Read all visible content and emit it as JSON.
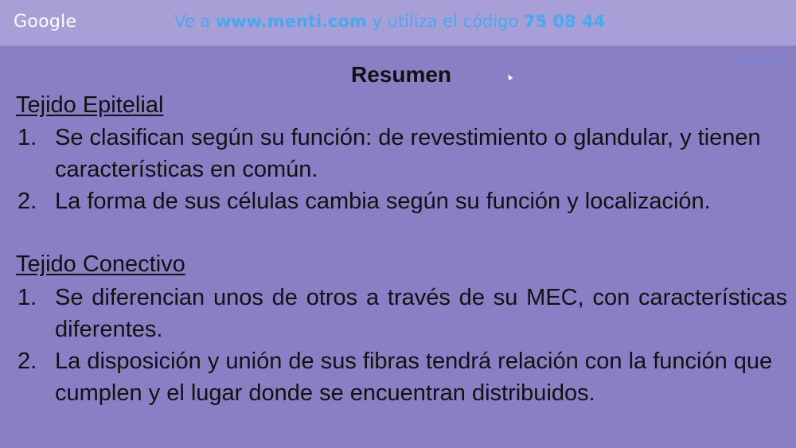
{
  "topbar": {
    "logo_text": "Google",
    "banner_prefix": "Ve a ",
    "banner_url": "www.menti.com",
    "banner_middle": " y utiliza el código ",
    "banner_code": "75 08 44"
  },
  "corner_badge": "M Mentimeter",
  "slide": {
    "title": "Resumen",
    "sections": [
      {
        "heading": "Tejido Epitelial",
        "items": [
          {
            "number": "1.",
            "text": "Se  clasifican según su función: de revestimiento o glandular, y tienen características en común."
          },
          {
            "number": "2.",
            "text": "La forma de sus células cambia según su función y localización."
          }
        ]
      },
      {
        "heading": "Tejido Conectivo",
        "items": [
          {
            "number": "1.",
            "text": "Se diferencian unos de otros a través de su MEC, con características diferentes."
          },
          {
            "number": "2.",
            "text": "La disposición y unión de sus fibras tendrá relación con la función que cumplen y el lugar donde se encuentran distribuidos."
          }
        ]
      }
    ]
  }
}
